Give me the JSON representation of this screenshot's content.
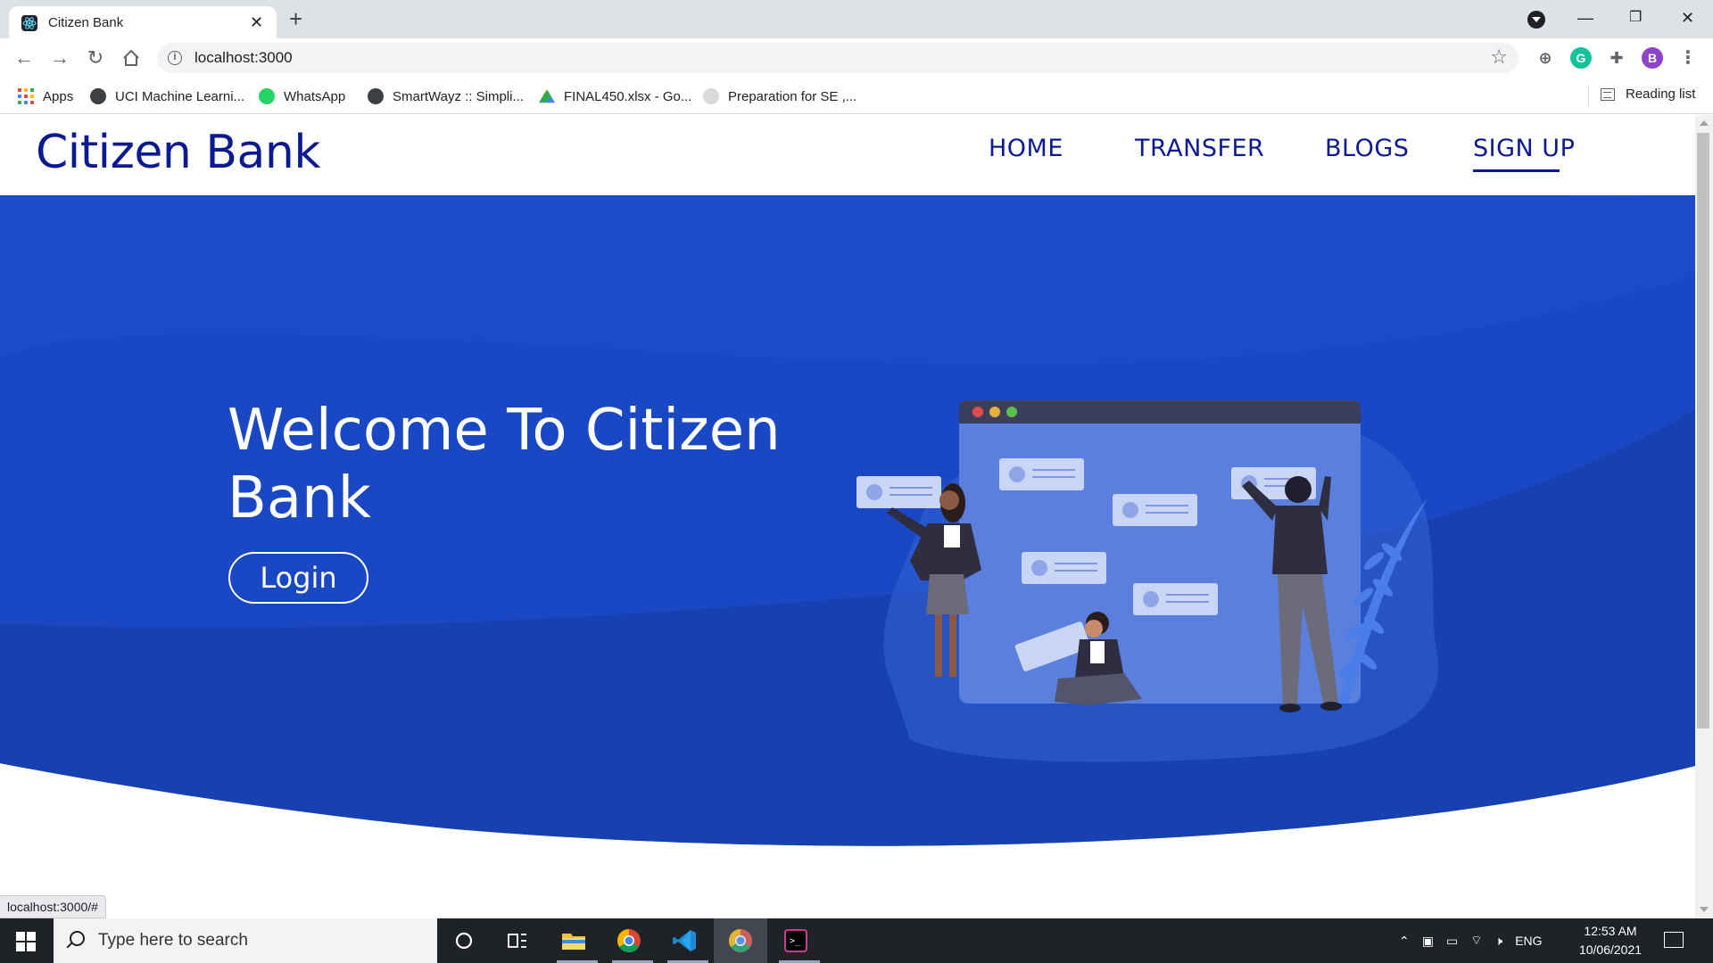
{
  "browser": {
    "tab_title": "Citizen Bank",
    "url": "localhost:3000",
    "status_url": "localhost:3000/#",
    "profile_initial": "B",
    "bookmarks": [
      {
        "label": "Apps",
        "icon": "apps-grid-icon"
      },
      {
        "label": "UCI Machine Learni...",
        "icon": "globe-icon"
      },
      {
        "label": "WhatsApp",
        "icon": "whatsapp-icon"
      },
      {
        "label": "SmartWayz :: Simpli...",
        "icon": "globe-icon"
      },
      {
        "label": "FINAL450.xlsx - Go...",
        "icon": "google-drive-icon"
      },
      {
        "label": "Preparation for SE ,...",
        "icon": "bulb-icon"
      }
    ],
    "reading_list": "Reading list"
  },
  "site": {
    "brand": "Citizen Bank",
    "nav": [
      {
        "label": "HOME"
      },
      {
        "label": "TRANSFER"
      },
      {
        "label": "BLOGS"
      },
      {
        "label": "SIGN UP",
        "active": true
      }
    ],
    "hero": {
      "title": "Welcome To Citizen Bank",
      "login_label": "Login"
    },
    "colors": {
      "brand_navy": "#0c1a8f",
      "hero_blue": "#1a47c4",
      "hero_dark": "#173ea8"
    }
  },
  "taskbar": {
    "search_placeholder": "Type here to search",
    "tray_language": "ENG",
    "time": "12:53 AM",
    "date": "10/06/2021",
    "pinned": [
      "cortana-icon",
      "task-view-icon",
      "file-explorer-icon",
      "chrome-icon",
      "vscode-icon",
      "chrome-icon",
      "terminal-icon"
    ]
  }
}
